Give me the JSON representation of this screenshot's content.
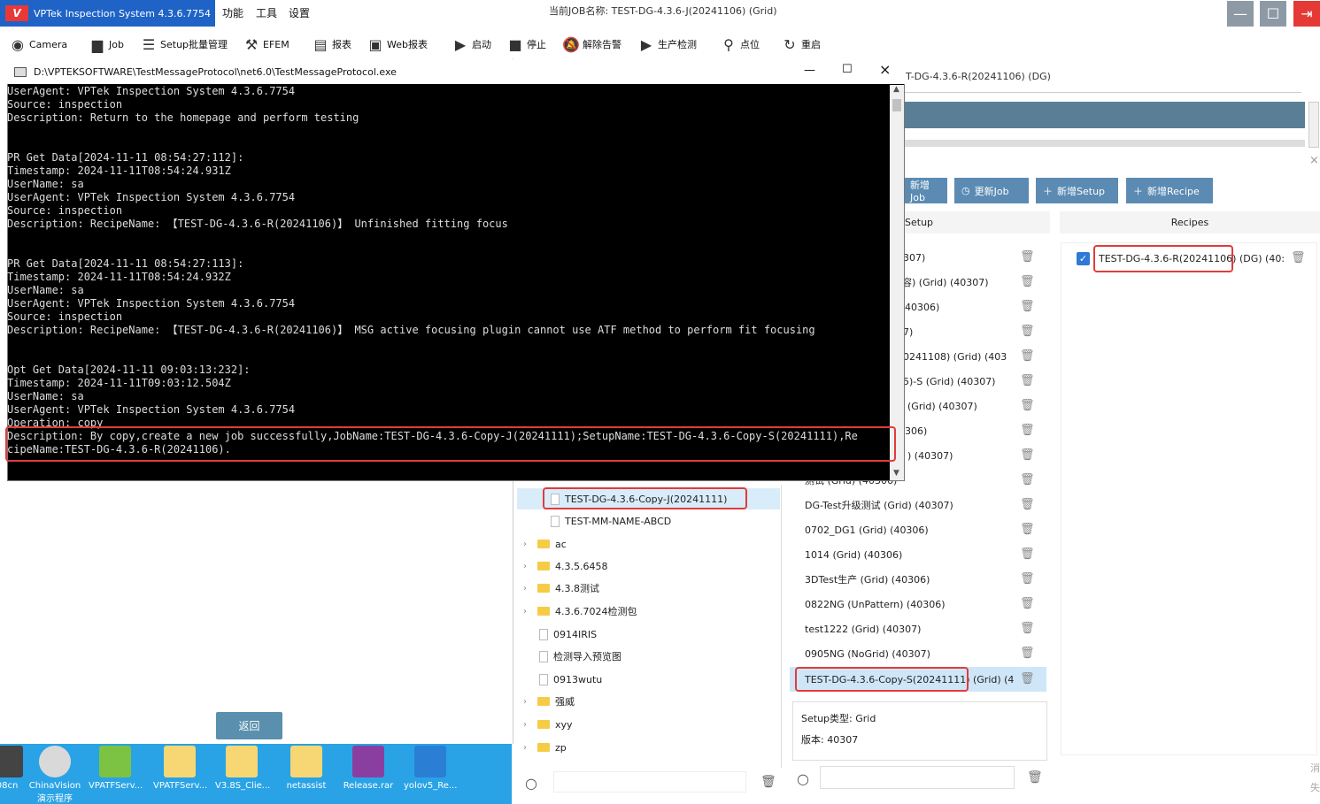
{
  "app": {
    "title": "VPTek Inspection System 4.3.6.7754",
    "logo": "V",
    "menus": [
      "功能",
      "工具",
      "设置"
    ],
    "current_job": "当前JOB名称: TEST-DG-4.3.6-J(20241106) (Grid)"
  },
  "toolbar": [
    "Camera",
    "Job",
    "Setup批量管理",
    "EFEM",
    "报表",
    "Web报表",
    "启动",
    "停止",
    "解除告警",
    "生产检测",
    "点位",
    "重启"
  ],
  "console": {
    "title": "D:\\VPTEKSOFTWARE\\TestMessageProtocol\\net6.0\\TestMessageProtocol.exe",
    "lines": [
      "UserAgent: VPTek Inspection System 4.3.6.7754",
      "Source: inspection",
      "Description: Return to the homepage and perform testing",
      "",
      "",
      "PR Get Data[2024-11-11 08:54:27:112]:",
      "Timestamp: 2024-11-11T08:54:24.931Z",
      "UserName: sa",
      "UserAgent: VPTek Inspection System 4.3.6.7754",
      "Source: inspection",
      "Description: RecipeName: 【TEST-DG-4.3.6-R(20241106)】 Unfinished fitting focus",
      "",
      "",
      "PR Get Data[2024-11-11 08:54:27:113]:",
      "Timestamp: 2024-11-11T08:54:24.932Z",
      "UserName: sa",
      "UserAgent: VPTek Inspection System 4.3.6.7754",
      "Source: inspection",
      "Description: RecipeName: 【TEST-DG-4.3.6-R(20241106)】 MSG active focusing plugin cannot use ATF method to perform fit focusing",
      "",
      "",
      "Opt Get Data[2024-11-11 09:03:13:232]:",
      "Timestamp: 2024-11-11T09:03:12.504Z",
      "UserName: sa",
      "UserAgent: VPTek Inspection System 4.3.6.7754",
      "Operation: copy",
      "Description: By copy,create a new job successfully,JobName:TEST-DG-4.3.6-Copy-J(20241111);SetupName:TEST-DG-4.3.6-Copy-S(20241111),Re",
      "cipeName:TEST-DG-4.3.6-R(20241106)."
    ]
  },
  "back": "返回",
  "taskbar": [
    "08cn",
    "ChinaVision 演示程序",
    "VPATFServ...",
    "VPATFServ...",
    "V3.8S_Clie...",
    "netassist",
    "Release.rar",
    "yolov5_Re..."
  ],
  "recipe_header": "T-DG-4.3.6-R(20241106) (DG)",
  "buttons": [
    "新增Job",
    "更新Job",
    "新增Setup",
    "新增Recipe"
  ],
  "col_headers": {
    "setup": "Setup",
    "recipes": "Recipes"
  },
  "setups": [
    "307)",
    "容)  (Grid) (40307)",
    "40306)",
    "7)",
    "0241108) (Grid) (403",
    "5)-S (Grid) (40307)",
    "(Grid) (40307)",
    "306)",
    ") (40307)",
    "测试 (Grid) (40306)",
    "DG-Test升级测试 (Grid) (40307)",
    "0702_DG1 (Grid) (40306)",
    "1014 (Grid) (40306)",
    "3DTest生产 (Grid) (40306)",
    "0822NG (UnPattern) (40306)",
    "test1222 (Grid) (40307)",
    "0905NG (NoGrid) (40307)",
    "TEST-DG-4.3.6-Copy-S(20241111) (Grid) (4"
  ],
  "setup_info": {
    "type": "Setup类型: Grid",
    "version": "版本: 40307"
  },
  "recipe": "TEST-DG-4.3.6-R(20241106) (DG) (40:",
  "tree": {
    "selected": "TEST-DG-4.3.6-Copy-J(20241111)",
    "items": [
      "TEST-MM-NAME-ABCD",
      "ac",
      "4.3.5.6458",
      "4.3.8测试",
      "4.3.6.7024检测包",
      "0914IRIS",
      "检测导入预览图",
      "0913wutu",
      "强威",
      "xyy",
      "zp"
    ]
  },
  "side_text": "消 失"
}
